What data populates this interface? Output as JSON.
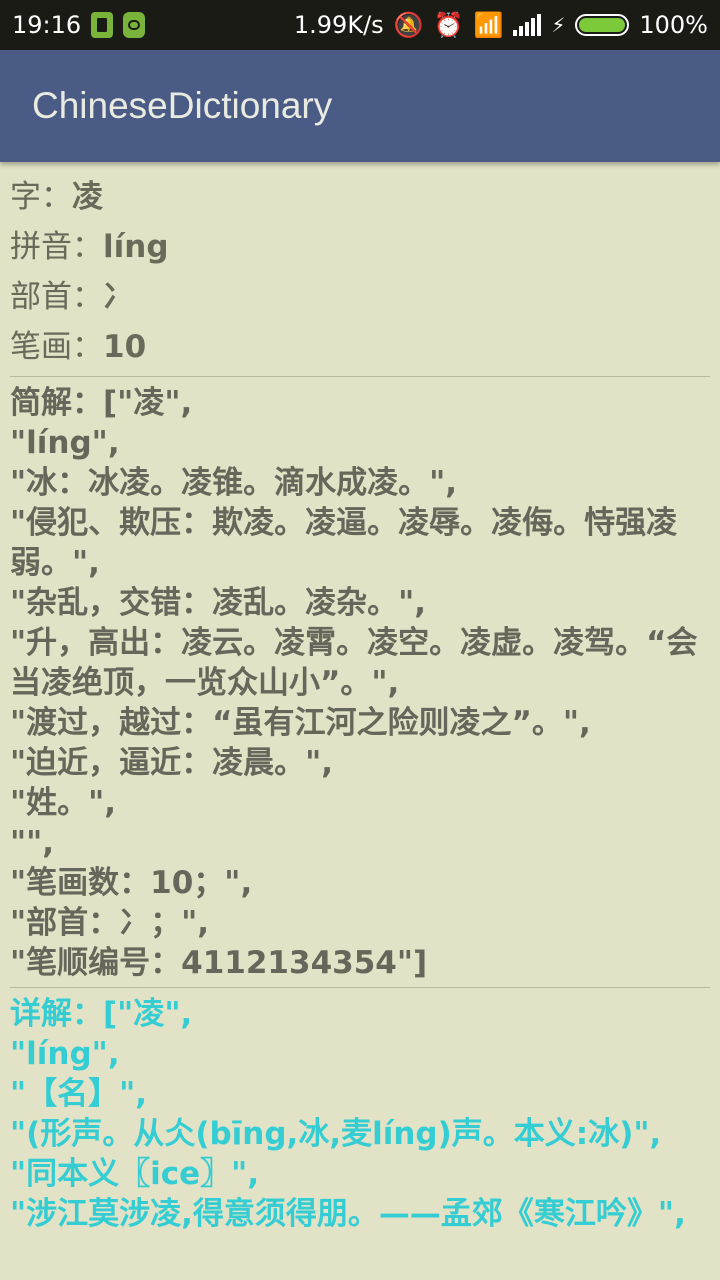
{
  "status_bar": {
    "time": "19:16",
    "speed": "1.99K/s",
    "battery": "100%",
    "icons": [
      "file-icon",
      "cat-icon",
      "mute-icon",
      "alarm-icon",
      "wifi-icon",
      "signal-icon",
      "bolt-icon",
      "battery-icon"
    ]
  },
  "app_bar": {
    "title": "ChineseDictionary"
  },
  "entry": {
    "char_label": "字：",
    "char": "凌",
    "pinyin_label": "拼音：",
    "pinyin": "líng",
    "radical_label": "部首：",
    "radical": "冫",
    "strokes_label": "笔画：",
    "strokes": "10"
  },
  "brief": {
    "text": "简解：[\"凌\",\n\"líng\",\n\"冰：冰凌。凌锥。滴水成凌。\",\n\"侵犯、欺压：欺凌。凌逼。凌辱。凌侮。恃强凌弱。\",\n\"杂乱，交错：凌乱。凌杂。\",\n\"升，高出：凌云。凌霄。凌空。凌虚。凌驾。“会当凌绝顶，一览众山小”。\",\n\"渡过，越过：“虽有江河之险则凌之”。\",\n\"迫近，逼近：凌晨。\",\n\"姓。\",\n\"\",\n\"笔画数：10；\",\n\"部首：冫；\",\n\"笔顺编号：4112134354\"]"
  },
  "detail": {
    "text": "详解：[\"凌\",\n\"líng\",\n\"【名】\",\n\"(形声。从仌(bīng,冰,麦líng)声。本义:冰)\",\n\"同本义〖ice〗\",\n\"涉江莫涉凌,得意须得朋。——孟郊《寒江吟》\","
  },
  "colors": {
    "background": "#e1e2c6",
    "app_bar": "#4a5b86",
    "text": "#66665a",
    "detail_text": "#33cdd3",
    "status_bar": "#1b1b16"
  }
}
